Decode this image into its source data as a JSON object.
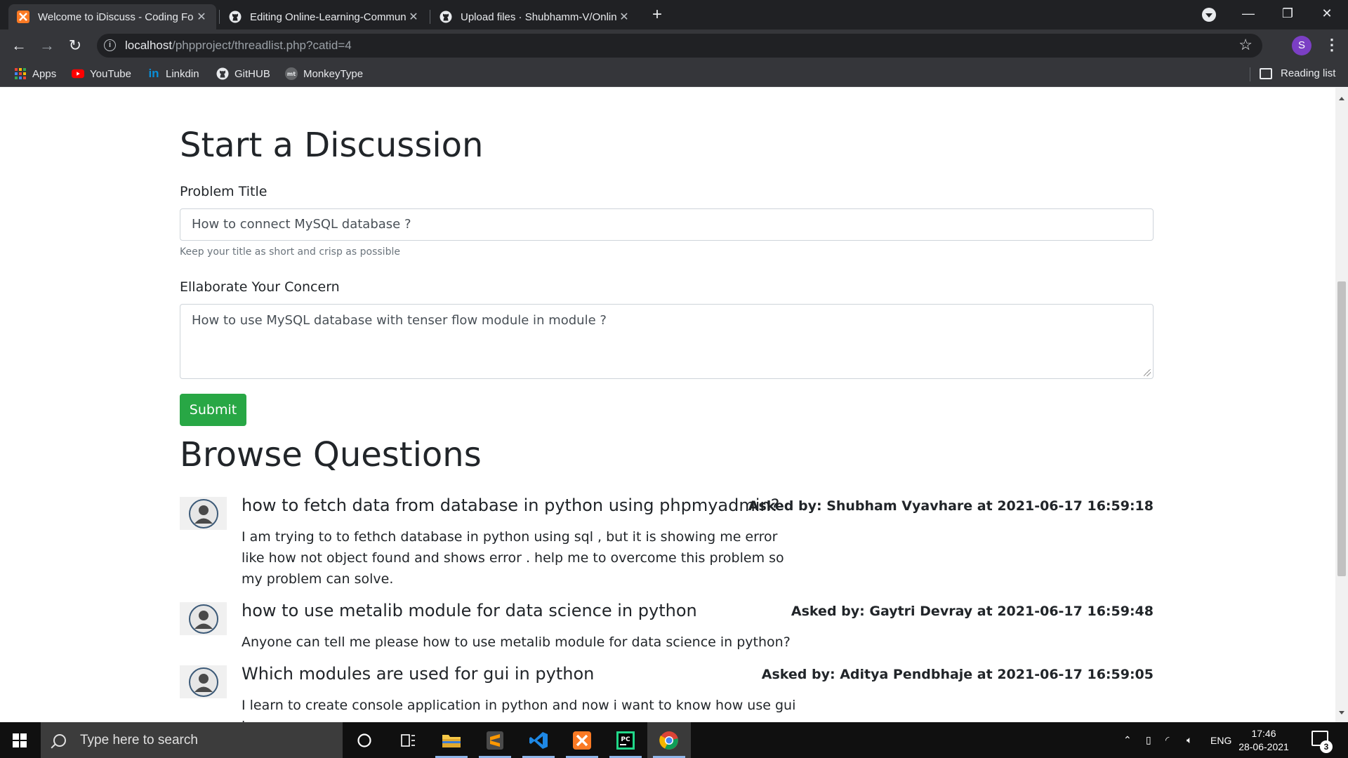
{
  "browser": {
    "tabs": [
      {
        "title": "Welcome to iDiscuss - Coding Fo",
        "active": true
      },
      {
        "title": "Editing Online-Learning-Commun",
        "active": false
      },
      {
        "title": "Upload files · Shubhamm-V/Onlin",
        "active": false
      }
    ],
    "url_host": "localhost",
    "url_path": "/phpproject/threadlist.php?catid=4",
    "profile_initial": "S",
    "bookmarks": [
      "Apps",
      "YouTube",
      "Linkdin",
      "GitHUB",
      "MonkeyType"
    ],
    "reading_list": "Reading list"
  },
  "page": {
    "heading": "Start a Discussion",
    "form": {
      "title_label": "Problem Title",
      "title_value": "How to connect MySQL database ?",
      "title_help": "Keep your title as short and crisp as possible",
      "concern_label": "Ellaborate Your Concern",
      "concern_value": "How to use MySQL database with tenser flow  module in module ?",
      "submit_label": "Submit"
    },
    "browse_heading": "Browse Questions",
    "questions": [
      {
        "title": "how to fetch data from database in python using phpmyadmin?",
        "meta": "Asked by: Shubham Vyavhare at 2021-06-17 16:59:18",
        "desc": "I am trying to to fethch database in python using sql , but it is showing me error like how not object found and shows error . help me to overcome this problem so my problem can solve."
      },
      {
        "title": "how to use metalib module for data science in python",
        "meta": "Asked by: Gaytri Devray at 2021-06-17 16:59:48",
        "desc": "Anyone can tell me please how to use metalib module for data science in python?"
      },
      {
        "title": "Which modules are used for gui in python",
        "meta": "Asked by: Aditya Pendbhaje at 2021-06-17 16:59:05",
        "desc": "I learn to create console application in python and now i want to know how use gui in"
      }
    ]
  },
  "taskbar": {
    "search_placeholder": "Type here to search",
    "language": "ENG",
    "time": "17:46",
    "date": "28-06-2021",
    "notification_count": "3"
  },
  "colors": {
    "submit": "#28a745",
    "chrome_dark": "#202124",
    "chrome_toolbar": "#35363a",
    "profile": "#7b3fc4"
  }
}
